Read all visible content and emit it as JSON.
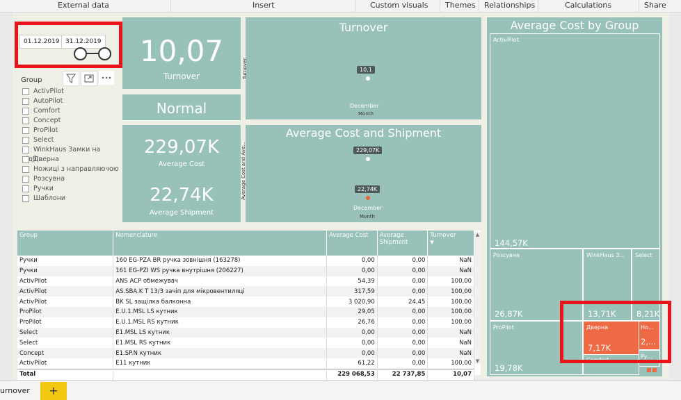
{
  "ribbon": {
    "items": [
      "External data",
      "Insert",
      "Custom visuals",
      "Themes",
      "Relationships",
      "Calculations",
      "Share"
    ]
  },
  "slicer": {
    "date_start": "01.12.2019",
    "date_end": "31.12.2019",
    "group_title": "Group",
    "groups": [
      "ActivPilot",
      "AutoPilot",
      "Comfort",
      "Concept",
      "ProPilot",
      "Select",
      "WinkHaus Замки на відб...",
      "Дверна",
      "Ножиці з направляючою",
      "Розсувна",
      "Ручки",
      "Шаблони"
    ]
  },
  "cards": {
    "turnover_value": "10,07",
    "turnover_label": "Turnover",
    "status_value": "Normal",
    "avg_cost_value": "229,07K",
    "avg_cost_label": "Average Cost",
    "avg_ship_value": "22,74K",
    "avg_ship_label": "Average Shipment"
  },
  "turnover_chart": {
    "title": "Turnover",
    "y_axis": "Turnover",
    "point_label": "10,1",
    "x_tick": "December",
    "x_axis": "Month"
  },
  "avg_chart": {
    "title": "Average Cost and Shipment",
    "y_axis": "Average Cost and Ave...",
    "label_cost": "229,07K",
    "label_ship": "22,74K",
    "x_tick": "December",
    "x_axis": "Month"
  },
  "chart_data": [
    {
      "type": "line",
      "title": "Turnover",
      "categories": [
        "December"
      ],
      "series": [
        {
          "name": "Turnover",
          "values": [
            10.1
          ]
        }
      ],
      "xlabel": "Month",
      "ylabel": "Turnover"
    },
    {
      "type": "line",
      "title": "Average Cost and Shipment",
      "categories": [
        "December"
      ],
      "series": [
        {
          "values": [
            229070
          ]
        },
        {
          "values": [
            22740
          ]
        }
      ],
      "xlabel": "Month",
      "ylabel": "Average Cost and Ave..."
    }
  ],
  "treemap": {
    "title": "Average Cost by Group",
    "cells": [
      {
        "name": "ActivPilot",
        "value": "144,57K"
      },
      {
        "name": "Розсувна",
        "value": "26,87K"
      },
      {
        "name": "WinkHaus З...",
        "value": "13,71K"
      },
      {
        "name": "Select",
        "value": "8,21K"
      },
      {
        "name": "ProPilot",
        "value": "19,78K"
      },
      {
        "name": "Дверна",
        "value": "7,17K"
      },
      {
        "name": "Но...",
        "value": "2,..."
      },
      {
        "name": "Comfort",
        "value": ""
      },
      {
        "name": "Ру...",
        "value": ""
      }
    ]
  },
  "table": {
    "headers": [
      "Group",
      "Nomenclature",
      "Average Cost",
      "Average Shipment",
      "Turnover"
    ],
    "rows": [
      [
        "Ручки",
        "160 EG-PZA BR ручка зовнішня (163278)",
        "0,00",
        "0,00",
        "NaN"
      ],
      [
        "Ручки",
        "161 EG-PZI WS ручка внутрішня (206227)",
        "0,00",
        "0,00",
        "NaN"
      ],
      [
        "ActivPilot",
        "ANS ACP обмежувач",
        "54,39",
        "0,00",
        "100,00"
      ],
      [
        "ActivPilot",
        "AS.SBA.K T 13/3 зачіп для мікровентиляці",
        "317,59",
        "0,00",
        "100,00"
      ],
      [
        "ActivPilot",
        "BK SL защілка балконна",
        "3 020,90",
        "24,45",
        "100,00"
      ],
      [
        "ProPilot",
        "E.U.1.MSL LS кутник",
        "29,05",
        "0,00",
        "100,00"
      ],
      [
        "ProPilot",
        "E.U.1.MSL RS кутник",
        "26,76",
        "0,00",
        "100,00"
      ],
      [
        "Select",
        "E1.MSL LS кутник",
        "0,00",
        "0,00",
        "NaN"
      ],
      [
        "Select",
        "E1.MSL RS кутник",
        "0,00",
        "0,00",
        "NaN"
      ],
      [
        "Concept",
        "E1.SP.N кутник",
        "0,00",
        "0,00",
        "NaN"
      ],
      [
        "ActivPilot",
        "E11 кутник",
        "61,22",
        "0,00",
        "100,00"
      ]
    ],
    "total": [
      "Total",
      "",
      "229 068,53",
      "22 737,85",
      "10,07"
    ]
  },
  "tabs": {
    "active": "urnover",
    "add": "+"
  }
}
